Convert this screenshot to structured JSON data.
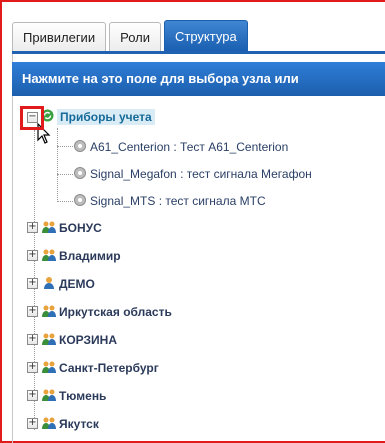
{
  "tabs": [
    {
      "label": "Привилегии",
      "active": false
    },
    {
      "label": "Роли",
      "active": false
    },
    {
      "label": "Структура",
      "active": true
    }
  ],
  "selector_bar": {
    "text": "Нажмите на это поле для выбора узла или"
  },
  "tree": {
    "root": {
      "label": "Приборы учета",
      "expanded": true
    },
    "devices": [
      {
        "label": "A61_Centerion : Тест A61_Centerion"
      },
      {
        "label": "Signal_Megafon : тест сигнала Мегафон"
      },
      {
        "label": "Signal_MTS : тест сигнала МТС"
      }
    ],
    "groups": [
      {
        "label": "БОНУС",
        "icon": "users-group-icon"
      },
      {
        "label": "Владимир",
        "icon": "users-group-icon"
      },
      {
        "label": "ДЕМО",
        "icon": "user-icon"
      },
      {
        "label": "Иркутская область",
        "icon": "users-group-icon"
      },
      {
        "label": "КОРЗИНА",
        "icon": "users-group-icon"
      },
      {
        "label": "Санкт-Петербург",
        "icon": "users-group-icon"
      },
      {
        "label": "Тюмень",
        "icon": "users-group-icon"
      },
      {
        "label": "Якутск",
        "icon": "users-group-icon"
      }
    ]
  },
  "colors": {
    "highlight": "#e11b1b",
    "tab_active": "#1f62b2"
  }
}
